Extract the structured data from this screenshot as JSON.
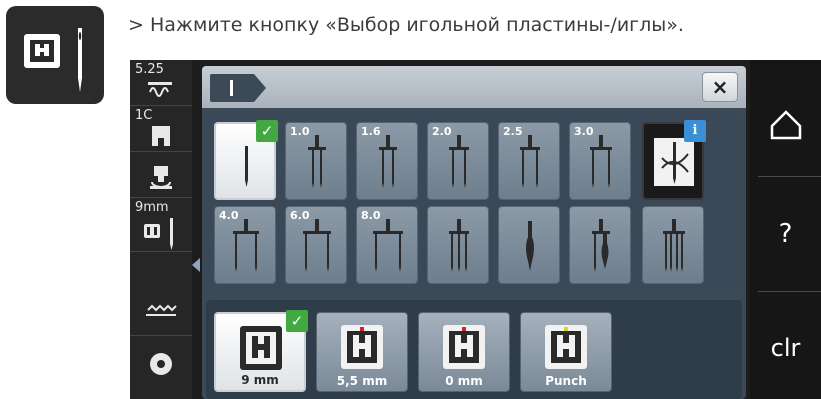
{
  "instruction": {
    "arrow": ">",
    "text": "Нажмите кнопку «Выбор игольной пластины-/иглы»."
  },
  "left_column": {
    "stitch_width": "5.25",
    "foot_code": "1C",
    "plate_value": "9mm"
  },
  "header": {
    "close_label": "×"
  },
  "needles_row1": [
    {
      "label": ""
    },
    {
      "label": "1.0"
    },
    {
      "label": "1.6"
    },
    {
      "label": "2.0"
    },
    {
      "label": "2.5"
    },
    {
      "label": "3.0"
    },
    {
      "label": ""
    }
  ],
  "needles_row2": [
    {
      "label": "4.0"
    },
    {
      "label": "6.0"
    },
    {
      "label": "8.0"
    },
    {
      "label": ""
    },
    {
      "label": ""
    },
    {
      "label": ""
    },
    {
      "label": ""
    }
  ],
  "plates": [
    {
      "label": "9 mm"
    },
    {
      "label": "5,5 mm"
    },
    {
      "label": "0 mm"
    },
    {
      "label": "Punch"
    }
  ],
  "right_column": {
    "home_icon": "home-icon",
    "help_label": "?",
    "clear_label": "clr"
  },
  "icons": {
    "check": "✓",
    "info": "i"
  },
  "colors": {
    "check_green": "#42a842",
    "info_blue": "#3a8fd6",
    "plate_marker_red": "#e02020",
    "plate_marker_yellow": "#e6d21a"
  }
}
